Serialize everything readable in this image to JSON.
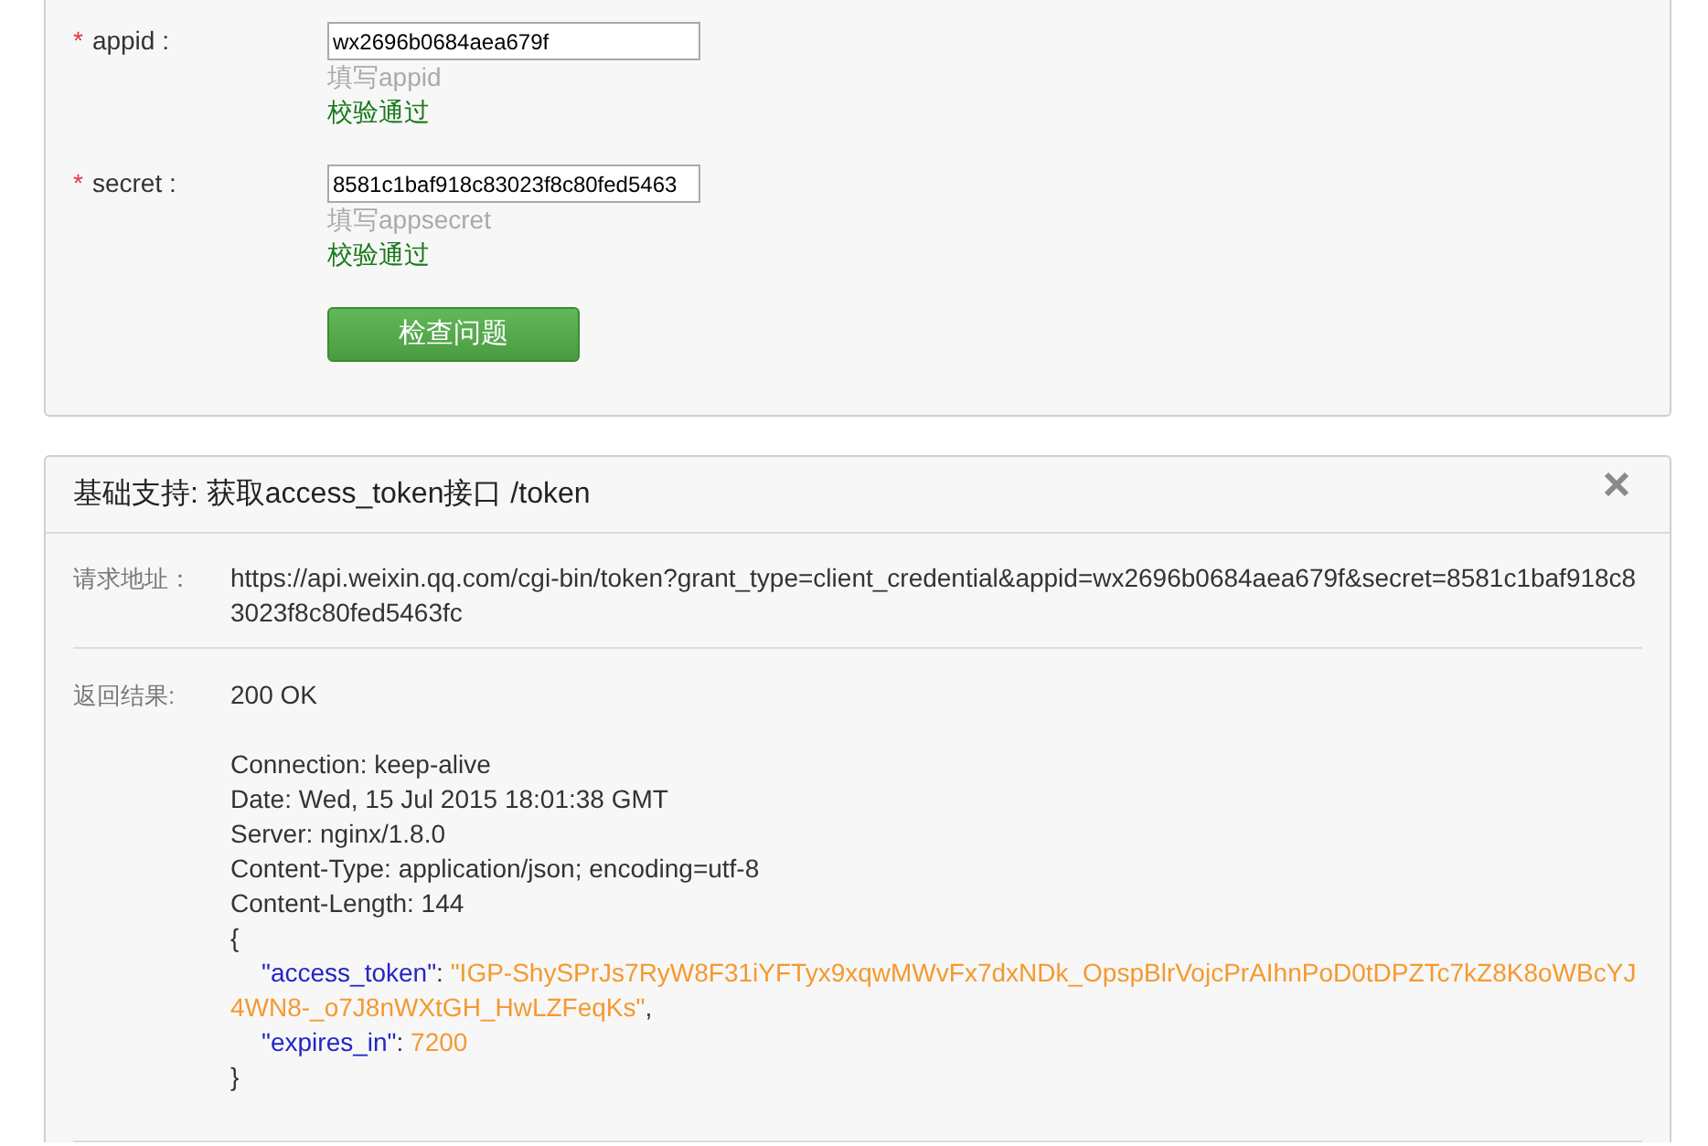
{
  "form": {
    "fields": [
      {
        "marker": "*",
        "label": "appid :",
        "value": "wx2696b0684aea679f",
        "help": "填写appid",
        "validation": {
          "text": "校验通过",
          "passed": true
        }
      },
      {
        "marker": "*",
        "label": "secret :",
        "value": "8581c1baf918c83023f8c80fed5463",
        "help": "填写appsecret",
        "validation": {
          "text": "校验通过",
          "passed": true
        }
      }
    ],
    "submit_button": "检查问题"
  },
  "result_panel": {
    "title": "基础支持: 获取access_token接口 /token",
    "request": {
      "label": "请求地址：",
      "url": "https://api.weixin.qq.com/cgi-bin/token?grant_type=client_credential&appid=wx2696b0684aea679f&secret=8581c1baf918c83023f8c80fed5463fc"
    },
    "response": {
      "label": "返回结果:",
      "status": "200 OK",
      "headers": [
        "Connection: keep-alive",
        "Date: Wed, 15 Jul 2015 18:01:38 GMT",
        "Server: nginx/1.8.0",
        "Content-Type: application/json; encoding=utf-8",
        "Content-Length: 144"
      ],
      "body": {
        "open": "{",
        "entries": [
          {
            "key": "\"access_token\"",
            "separator": ": ",
            "value": "\"IGP-ShySPrJs7RyW8F31iYFTyx9xqwMWvFx7dxNDk_OpspBlrVojcPrAIhnPoD0tDPZTc7kZ8K8oWBcYJ4WN8-_o7J8nWXtGH_HwLZFeqKs\"",
            "trailing": ","
          },
          {
            "key": "\"expires_in\"",
            "separator": ": ",
            "value": "7200"
          }
        ],
        "close": "}"
      }
    }
  }
}
